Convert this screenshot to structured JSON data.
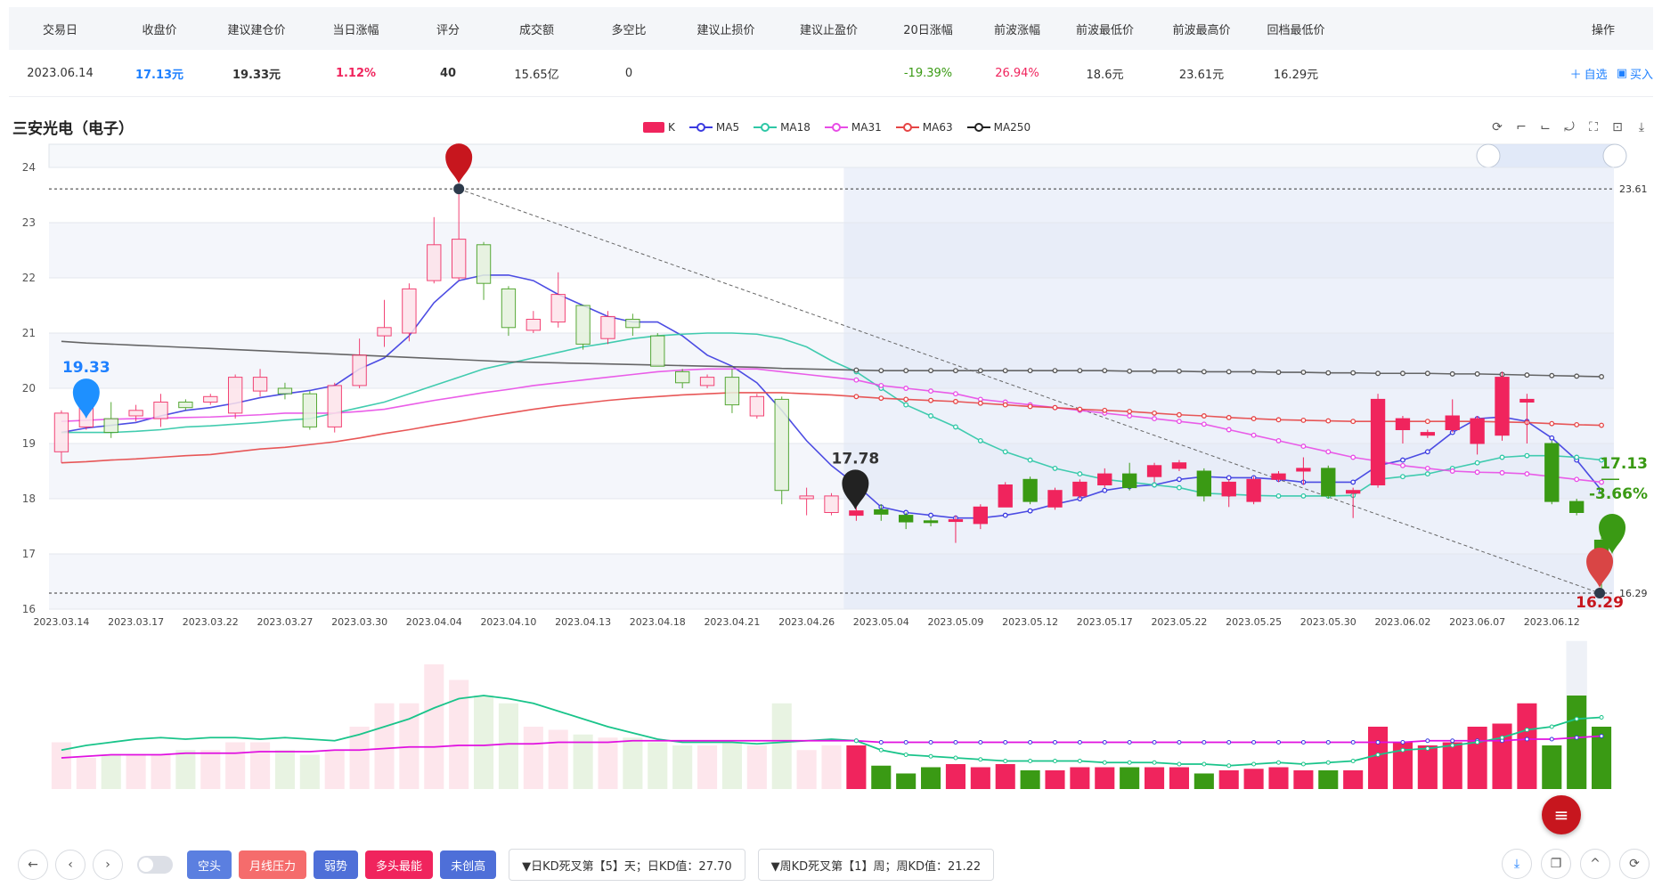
{
  "table": {
    "headers": [
      "交易日",
      "收盘价",
      "建议建仓价",
      "当日涨幅",
      "评分",
      "成交额",
      "多空比",
      "建议止损价",
      "建议止盈价",
      "20日涨幅",
      "前波涨幅",
      "前波最低价",
      "前波最高价",
      "回档最低价",
      "操作"
    ],
    "row": [
      "2023.06.14",
      "17.13元",
      "19.33元",
      "1.12%",
      "40",
      "15.65亿",
      "0",
      "",
      "",
      "-19.39%",
      "26.94%",
      "18.6元",
      "23.61元",
      "16.29元"
    ],
    "actions": {
      "watch": "自选",
      "buy": "买入"
    }
  },
  "colors": {
    "red": "#f0245d",
    "green": "#3a9a14",
    "blue": "#1e80ff",
    "dark_red": "#c7161e"
  },
  "stock_title": "三安光电（电子）",
  "legend": {
    "k": "K",
    "ma5": "MA5",
    "ma18": "MA18",
    "ma31": "MA31",
    "ma63": "MA63",
    "ma250": "MA250"
  },
  "chart_data": {
    "type": "candlestick",
    "dates": [
      "2023.03.14",
      "2023.03.15",
      "2023.03.16",
      "2023.03.17",
      "2023.03.20",
      "2023.03.21",
      "2023.03.22",
      "2023.03.23",
      "2023.03.24",
      "2023.03.27",
      "2023.03.28",
      "2023.03.29",
      "2023.03.30",
      "2023.03.31",
      "2023.04.03",
      "2023.04.04",
      "2023.04.06",
      "2023.04.07",
      "2023.04.10",
      "2023.04.11",
      "2023.04.12",
      "2023.04.13",
      "2023.04.14",
      "2023.04.17",
      "2023.04.18",
      "2023.04.19",
      "2023.04.20",
      "2023.04.21",
      "2023.04.24",
      "2023.04.25",
      "2023.04.26",
      "2023.04.27",
      "2023.04.28",
      "2023.05.04",
      "2023.05.05",
      "2023.05.08",
      "2023.05.09",
      "2023.05.10",
      "2023.05.11",
      "2023.05.12",
      "2023.05.15",
      "2023.05.16",
      "2023.05.17",
      "2023.05.18",
      "2023.05.19",
      "2023.05.22",
      "2023.05.23",
      "2023.05.24",
      "2023.05.25",
      "2023.05.26",
      "2023.05.29",
      "2023.05.30",
      "2023.05.31",
      "2023.06.01",
      "2023.06.02",
      "2023.06.05",
      "2023.06.06",
      "2023.06.07",
      "2023.06.08",
      "2023.06.09",
      "2023.06.12",
      "2023.06.13",
      "2023.06.14"
    ],
    "x_tick_labels": [
      "2023.03.14",
      "2023.03.17",
      "2023.03.22",
      "2023.03.27",
      "2023.03.30",
      "2023.04.04",
      "2023.04.10",
      "2023.04.13",
      "2023.04.18",
      "2023.04.21",
      "2023.04.26",
      "2023.05.04",
      "2023.05.09",
      "2023.05.12",
      "2023.05.17",
      "2023.05.22",
      "2023.05.25",
      "2023.05.30",
      "2023.06.02",
      "2023.06.07",
      "2023.06.12"
    ],
    "y_ticks": [
      16,
      17,
      18,
      19,
      20,
      21,
      22,
      23,
      24
    ],
    "ylim": [
      16,
      24
    ],
    "ohlc": [
      [
        18.85,
        19.55,
        18.65,
        19.6
      ],
      [
        19.3,
        19.75,
        19.25,
        19.8
      ],
      [
        19.45,
        19.2,
        19.1,
        19.75
      ],
      [
        19.5,
        19.6,
        19.4,
        19.7
      ],
      [
        19.45,
        19.75,
        19.3,
        19.9
      ],
      [
        19.75,
        19.65,
        19.6,
        19.8
      ],
      [
        19.75,
        19.85,
        19.7,
        19.9
      ],
      [
        19.55,
        20.2,
        19.45,
        20.25
      ],
      [
        19.95,
        20.2,
        19.85,
        20.35
      ],
      [
        20.0,
        19.9,
        19.8,
        20.1
      ],
      [
        19.9,
        19.3,
        19.25,
        19.95
      ],
      [
        19.3,
        20.05,
        19.2,
        20.1
      ],
      [
        20.05,
        20.6,
        20.0,
        20.9
      ],
      [
        20.95,
        21.1,
        20.75,
        21.6
      ],
      [
        21.0,
        21.8,
        20.85,
        21.9
      ],
      [
        21.95,
        22.6,
        21.9,
        23.1
      ],
      [
        22.0,
        22.7,
        21.95,
        23.61
      ],
      [
        22.6,
        21.9,
        21.6,
        22.65
      ],
      [
        21.8,
        21.1,
        20.95,
        21.85
      ],
      [
        21.05,
        21.25,
        21.0,
        21.4
      ],
      [
        21.2,
        21.7,
        21.1,
        22.1
      ],
      [
        21.5,
        20.8,
        20.7,
        21.5
      ],
      [
        20.9,
        21.3,
        20.8,
        21.4
      ],
      [
        21.25,
        21.1,
        20.95,
        21.35
      ],
      [
        20.95,
        20.4,
        20.4,
        21.0
      ],
      [
        20.3,
        20.1,
        20.0,
        20.35
      ],
      [
        20.05,
        20.2,
        20.0,
        20.25
      ],
      [
        20.2,
        19.7,
        19.55,
        20.35
      ],
      [
        19.5,
        19.85,
        19.45,
        19.9
      ],
      [
        19.8,
        18.15,
        17.9,
        19.85
      ],
      [
        18.0,
        18.05,
        17.7,
        18.2
      ],
      [
        17.75,
        18.05,
        17.7,
        18.1
      ],
      [
        17.7,
        17.78,
        17.6,
        17.85
      ],
      [
        17.8,
        17.72,
        17.6,
        17.9
      ],
      [
        17.7,
        17.58,
        17.45,
        17.75
      ],
      [
        17.6,
        17.58,
        17.5,
        17.65
      ],
      [
        17.6,
        17.62,
        17.2,
        17.7
      ],
      [
        17.55,
        17.85,
        17.45,
        17.9
      ],
      [
        17.85,
        18.25,
        17.85,
        18.3
      ],
      [
        18.35,
        17.95,
        17.9,
        18.4
      ],
      [
        17.85,
        18.15,
        17.8,
        18.2
      ],
      [
        18.05,
        18.3,
        18.0,
        18.35
      ],
      [
        18.25,
        18.45,
        18.2,
        18.55
      ],
      [
        18.45,
        18.2,
        18.15,
        18.65
      ],
      [
        18.4,
        18.6,
        18.3,
        18.65
      ],
      [
        18.55,
        18.65,
        18.5,
        18.7
      ],
      [
        18.5,
        18.05,
        17.95,
        18.55
      ],
      [
        18.05,
        18.3,
        17.85,
        18.35
      ],
      [
        17.95,
        18.35,
        17.9,
        18.4
      ],
      [
        18.35,
        18.45,
        18.3,
        18.5
      ],
      [
        18.5,
        18.55,
        18.25,
        18.75
      ],
      [
        18.55,
        18.05,
        18.0,
        18.6
      ],
      [
        18.1,
        18.15,
        17.65,
        18.2
      ],
      [
        18.25,
        19.8,
        18.2,
        19.9
      ],
      [
        19.25,
        19.45,
        19.0,
        19.5
      ],
      [
        19.15,
        19.2,
        19.1,
        19.25
      ],
      [
        19.25,
        19.5,
        19.2,
        19.8
      ],
      [
        19.0,
        19.45,
        18.8,
        19.5
      ],
      [
        19.15,
        20.2,
        19.05,
        20.3
      ],
      [
        19.75,
        19.8,
        19.0,
        19.9
      ],
      [
        19.0,
        17.95,
        17.9,
        19.05
      ],
      [
        17.95,
        17.75,
        17.7,
        18.0
      ],
      [
        17.25,
        17.05,
        16.29,
        17.3
      ]
    ],
    "ma": {
      "MA5": [
        19.2,
        19.28,
        19.33,
        19.38,
        19.5,
        19.6,
        19.65,
        19.73,
        19.83,
        19.9,
        19.96,
        20.05,
        20.35,
        20.55,
        20.95,
        21.55,
        21.95,
        22.05,
        22.05,
        21.95,
        21.7,
        21.5,
        21.3,
        21.2,
        21.2,
        20.95,
        20.6,
        20.4,
        20.1,
        19.6,
        19.05,
        18.6,
        18.25,
        17.85,
        17.75,
        17.7,
        17.65,
        17.65,
        17.7,
        17.78,
        17.9,
        18.0,
        18.15,
        18.22,
        18.25,
        18.35,
        18.4,
        18.38,
        18.38,
        18.35,
        18.3,
        18.3,
        18.3,
        18.6,
        18.7,
        18.85,
        19.2,
        19.45,
        19.48,
        19.4,
        19.1,
        18.7,
        18.15
      ],
      "MA18": [
        19.2,
        19.2,
        19.2,
        19.22,
        19.25,
        19.3,
        19.32,
        19.35,
        19.38,
        19.42,
        19.45,
        19.55,
        19.65,
        19.75,
        19.9,
        20.05,
        20.2,
        20.35,
        20.45,
        20.55,
        20.65,
        20.75,
        20.82,
        20.9,
        20.95,
        20.98,
        21.0,
        21.0,
        20.98,
        20.9,
        20.75,
        20.5,
        20.3,
        20.0,
        19.7,
        19.5,
        19.3,
        19.05,
        18.85,
        18.7,
        18.55,
        18.45,
        18.35,
        18.3,
        18.25,
        18.2,
        18.1,
        18.08,
        18.06,
        18.05,
        18.05,
        18.05,
        18.06,
        18.35,
        18.4,
        18.45,
        18.55,
        18.65,
        18.75,
        18.78,
        18.78,
        18.75,
        18.7
      ],
      "MA31": [
        19.4,
        19.42,
        19.44,
        19.45,
        19.46,
        19.47,
        19.48,
        19.5,
        19.52,
        19.55,
        19.55,
        19.55,
        19.58,
        19.62,
        19.7,
        19.78,
        19.85,
        19.92,
        19.98,
        20.05,
        20.1,
        20.15,
        20.2,
        20.25,
        20.3,
        20.33,
        20.35,
        20.35,
        20.35,
        20.3,
        20.25,
        20.2,
        20.15,
        20.05,
        20.0,
        19.95,
        19.9,
        19.8,
        19.75,
        19.7,
        19.65,
        19.6,
        19.55,
        19.5,
        19.45,
        19.4,
        19.35,
        19.25,
        19.15,
        19.05,
        18.95,
        18.85,
        18.75,
        18.68,
        18.6,
        18.55,
        18.5,
        18.48,
        18.47,
        18.45,
        18.4,
        18.35,
        18.3
      ],
      "MA63": [
        18.65,
        18.67,
        18.7,
        18.72,
        18.75,
        18.78,
        18.8,
        18.85,
        18.9,
        18.93,
        18.98,
        19.03,
        19.1,
        19.18,
        19.25,
        19.33,
        19.4,
        19.48,
        19.55,
        19.62,
        19.68,
        19.73,
        19.78,
        19.82,
        19.85,
        19.88,
        19.9,
        19.92,
        19.92,
        19.92,
        19.9,
        19.88,
        19.85,
        19.82,
        19.8,
        19.78,
        19.76,
        19.73,
        19.7,
        19.67,
        19.65,
        19.62,
        19.6,
        19.58,
        19.55,
        19.52,
        19.5,
        19.47,
        19.45,
        19.43,
        19.42,
        19.41,
        19.4,
        19.4,
        19.4,
        19.4,
        19.4,
        19.4,
        19.39,
        19.38,
        19.36,
        19.34,
        19.33
      ],
      "MA250": [
        20.85,
        20.82,
        20.8,
        20.78,
        20.76,
        20.74,
        20.72,
        20.7,
        20.68,
        20.66,
        20.64,
        20.62,
        20.6,
        20.58,
        20.56,
        20.54,
        20.52,
        20.5,
        20.48,
        20.47,
        20.46,
        20.45,
        20.44,
        20.43,
        20.42,
        20.41,
        20.4,
        20.39,
        20.38,
        20.36,
        20.35,
        20.34,
        20.33,
        20.32,
        20.32,
        20.32,
        20.32,
        20.32,
        20.32,
        20.32,
        20.32,
        20.32,
        20.32,
        20.31,
        20.31,
        20.31,
        20.3,
        20.3,
        20.3,
        20.29,
        20.29,
        20.28,
        20.28,
        20.27,
        20.27,
        20.27,
        20.26,
        20.26,
        20.25,
        20.24,
        20.23,
        20.22,
        20.21
      ]
    },
    "volume": [
      30,
      20,
      22,
      22,
      22,
      25,
      25,
      30,
      30,
      25,
      22,
      25,
      40,
      55,
      55,
      80,
      70,
      60,
      55,
      40,
      38,
      35,
      33,
      33,
      30,
      28,
      28,
      30,
      28,
      55,
      25,
      28,
      28,
      15,
      10,
      14,
      16,
      14,
      16,
      12,
      12,
      14,
      14,
      14,
      14,
      14,
      10,
      12,
      13,
      14,
      12,
      12,
      12,
      40,
      30,
      28,
      30,
      40,
      42,
      55,
      28,
      60,
      40
    ],
    "volume_lines": {
      "green": [
        25,
        28,
        30,
        32,
        33,
        32,
        33,
        33,
        32,
        33,
        32,
        31,
        35,
        40,
        45,
        52,
        58,
        60,
        58,
        55,
        50,
        45,
        40,
        36,
        32,
        30,
        30,
        30,
        29,
        30,
        31,
        32,
        31,
        25,
        22,
        21,
        20,
        19,
        18,
        18,
        18,
        18,
        17,
        17,
        17,
        16,
        16,
        15,
        16,
        17,
        16,
        17,
        18,
        22,
        25,
        26,
        28,
        30,
        33,
        38,
        40,
        45,
        46
      ],
      "magenta": [
        20,
        21,
        22,
        22,
        22,
        23,
        23,
        23,
        24,
        24,
        24,
        25,
        25,
        26,
        27,
        27,
        28,
        28,
        29,
        29,
        30,
        30,
        30,
        31,
        31,
        31,
        31,
        31,
        31,
        31,
        31,
        31,
        31,
        30,
        30,
        30,
        30,
        30,
        30,
        30,
        30,
        30,
        30,
        30,
        30,
        30,
        30,
        30,
        30,
        30,
        30,
        30,
        30,
        30,
        30,
        31,
        31,
        31,
        31,
        32,
        32,
        33,
        34
      ]
    },
    "pins": {
      "start": "19.33",
      "high": "23.61",
      "mid": "17.78",
      "low": "16.29",
      "current": "17.13",
      "change": "-3.66%"
    },
    "h_lines": {
      "top": "23.61",
      "bottom": "16.29"
    }
  },
  "bottom_bar": {
    "tags": [
      "空头",
      "月线压力",
      "弱势",
      "多头最能",
      "未创高"
    ],
    "tag_colors": [
      "#5b7fe0",
      "#f56c6c",
      "#4e6fd8",
      "#f0245d",
      "#4e6fd8"
    ],
    "kd_day": "▼日KD死叉第【5】天；日KD值：27.70",
    "kd_week": "▼周KD死叉第【1】周；周KD值：21.22"
  }
}
